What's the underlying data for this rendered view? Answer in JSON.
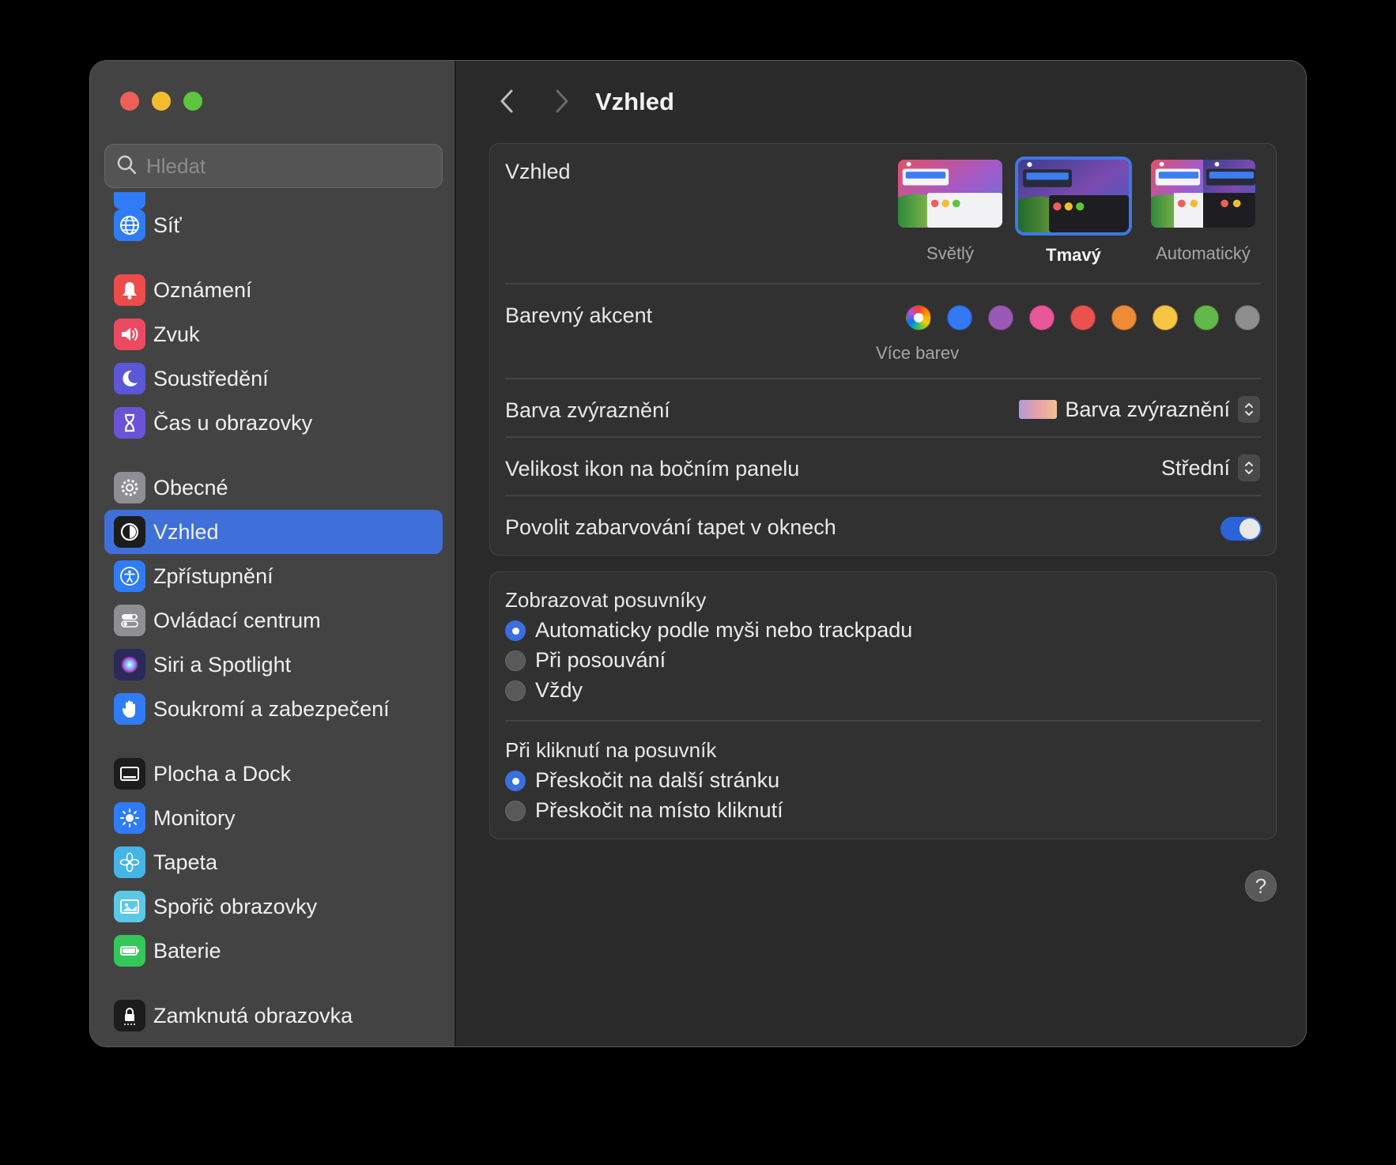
{
  "window": {
    "title": "Vzhled"
  },
  "search": {
    "placeholder": "Hledat"
  },
  "sidebar": {
    "items": [
      {
        "label": "Síť",
        "icon": "globe-icon",
        "color": "#2f7cf6"
      },
      {
        "label": "Oznámení",
        "icon": "bell-icon",
        "color": "#ee4b4b"
      },
      {
        "label": "Zvuk",
        "icon": "speaker-icon",
        "color": "#ec4a63"
      },
      {
        "label": "Soustředění",
        "icon": "moon-icon",
        "color": "#5b57d6"
      },
      {
        "label": "Čas u obrazovky",
        "icon": "hourglass-icon",
        "color": "#6a53d6"
      },
      {
        "label": "Obecné",
        "icon": "gear-icon",
        "color": "#8e8e93"
      },
      {
        "label": "Vzhled",
        "icon": "appearance-icon",
        "color": "#1c1c1c"
      },
      {
        "label": "Zpřístupnění",
        "icon": "accessibility-icon",
        "color": "#2f7cf6"
      },
      {
        "label": "Ovládací centrum",
        "icon": "control-center-icon",
        "color": "#8e8e93"
      },
      {
        "label": "Siri a Spotlight",
        "icon": "siri-icon",
        "color": "#2a2a5a"
      },
      {
        "label": "Soukromí a zabezpečení",
        "icon": "hand-icon",
        "color": "#2f7cf6"
      },
      {
        "label": "Plocha a Dock",
        "icon": "dock-icon",
        "color": "#1c1c1c"
      },
      {
        "label": "Monitory",
        "icon": "sun-icon",
        "color": "#2f7cf6"
      },
      {
        "label": "Tapeta",
        "icon": "flower-icon",
        "color": "#45b4e8"
      },
      {
        "label": "Spořič obrazovky",
        "icon": "screensaver-icon",
        "color": "#5ac8e6"
      },
      {
        "label": "Baterie",
        "icon": "battery-icon",
        "color": "#34c759"
      },
      {
        "label": "Zamknutá obrazovka",
        "icon": "lock-icon",
        "color": "#1c1c1c"
      }
    ],
    "selected": "Vzhled"
  },
  "main": {
    "title": "Vzhled",
    "appearance": {
      "label": "Vzhled",
      "options": [
        "Světlý",
        "Tmavý",
        "Automatický"
      ],
      "selected": "Tmavý"
    },
    "accent": {
      "label": "Barevný akcent",
      "colors": [
        "multicolor",
        "#3478f6",
        "#9b59b6",
        "#e9579b",
        "#e9524f",
        "#ef8b34",
        "#f6c544",
        "#62b84a",
        "#8e8e8e"
      ],
      "caption": "Více barev"
    },
    "highlight": {
      "label": "Barva zvýraznění",
      "value": "Barva zvýraznění"
    },
    "icon_size": {
      "label": "Velikost ikon na bočním panelu",
      "value": "Střední"
    },
    "tinting": {
      "label": "Povolit zabarvování tapet v oknech",
      "enabled": true
    },
    "scrollbars": {
      "title": "Zobrazovat posuvníky",
      "options": [
        "Automaticky podle myši nebo trackpadu",
        "Při posouvání",
        "Vždy"
      ],
      "selected": 0
    },
    "click": {
      "title": "Při kliknutí na posuvník",
      "options": [
        "Přeskočit na další stránku",
        "Přeskočit na místo kliknutí"
      ],
      "selected": 0
    },
    "help": "?"
  }
}
